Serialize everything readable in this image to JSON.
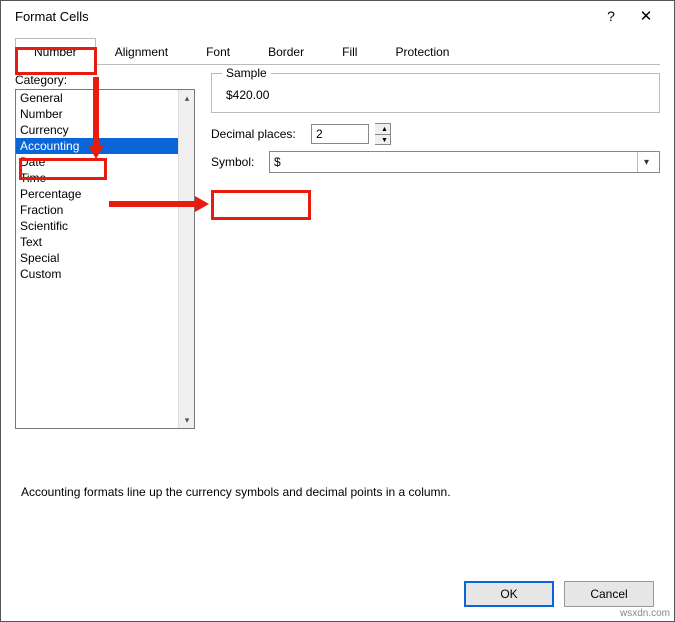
{
  "window": {
    "title": "Format Cells",
    "help": "?",
    "close": "✕"
  },
  "tabs": [
    "Number",
    "Alignment",
    "Font",
    "Border",
    "Fill",
    "Protection"
  ],
  "active_tab_index": 0,
  "category": {
    "label": "Category:",
    "items": [
      "General",
      "Number",
      "Currency",
      "Accounting",
      "Date",
      "Time",
      "Percentage",
      "Fraction",
      "Scientific",
      "Text",
      "Special",
      "Custom"
    ],
    "selected_index": 3
  },
  "sample": {
    "label": "Sample",
    "value": "$420.00"
  },
  "decimal": {
    "label": "Decimal places:",
    "value": "2"
  },
  "symbol": {
    "label": "Symbol:",
    "value": "$"
  },
  "description": "Accounting formats line up the currency symbols and decimal points in a column.",
  "buttons": {
    "ok": "OK",
    "cancel": "Cancel"
  },
  "watermark": "wsxdn.com"
}
